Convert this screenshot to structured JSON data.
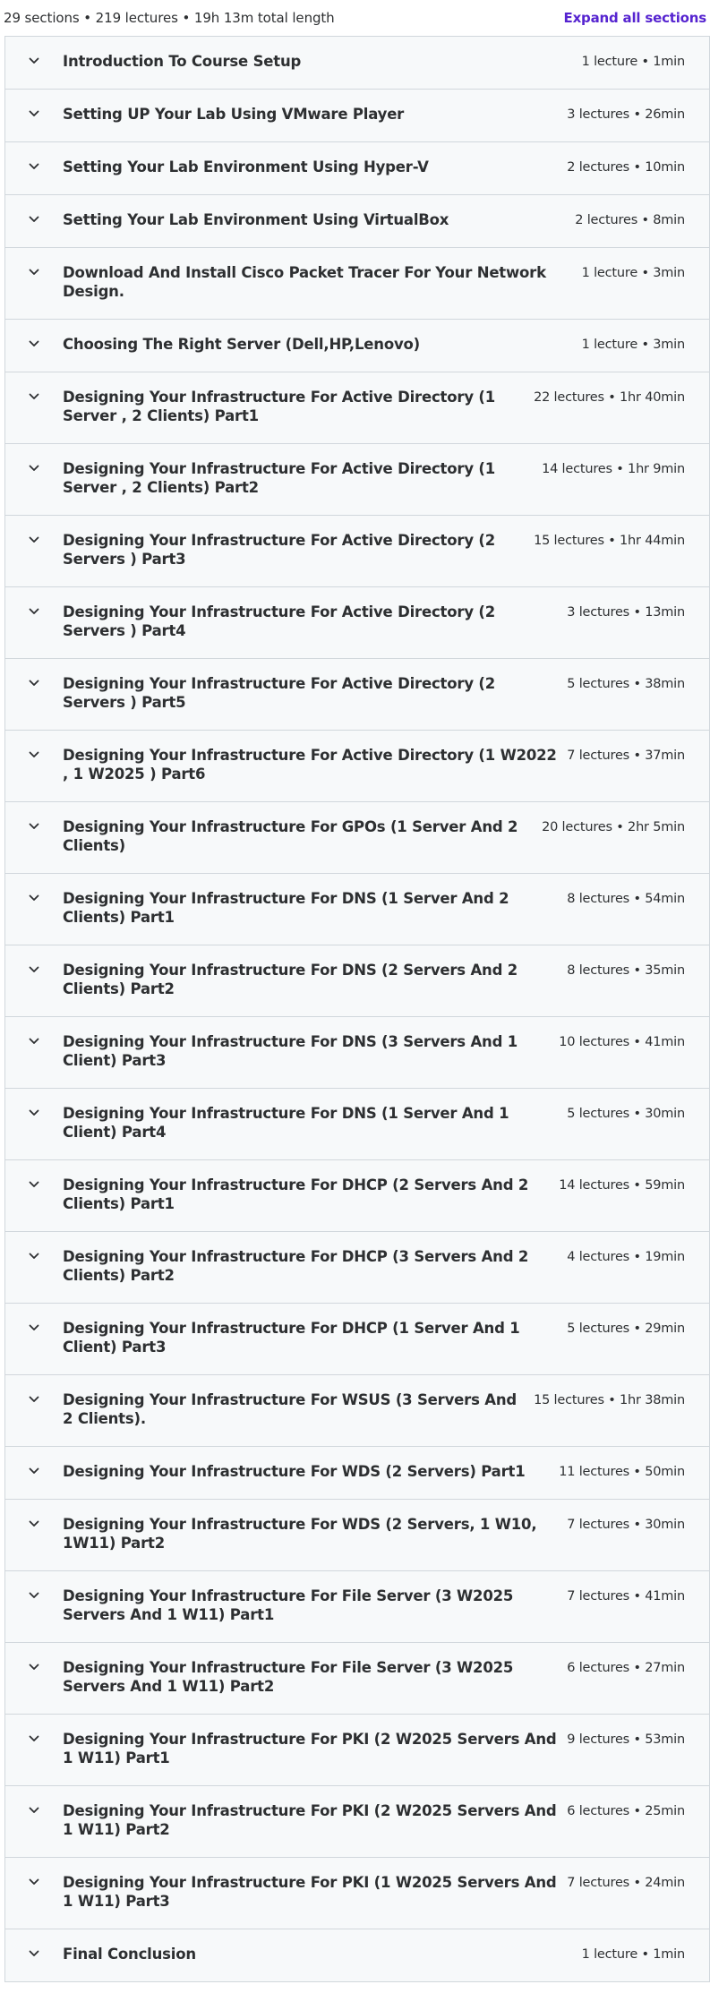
{
  "header": {
    "summary": "29 sections • 219 lectures • 19h 13m total length",
    "expand_label": "Expand all sections"
  },
  "colors": {
    "accent": "#5624d0",
    "row_bg": "#f7f9fa",
    "border": "#d1d7dc",
    "text": "#2d2f31"
  },
  "icons": {
    "toggle": "chevron-down-icon"
  },
  "sections": [
    {
      "title": "Introduction To Course Setup",
      "meta": "1 lecture • 1min"
    },
    {
      "title": "Setting UP Your Lab Using VMware Player",
      "meta": "3 lectures • 26min"
    },
    {
      "title": "Setting Your Lab Environment Using Hyper-V",
      "meta": "2 lectures • 10min"
    },
    {
      "title": "Setting Your Lab Environment Using VirtualBox",
      "meta": "2 lectures • 8min"
    },
    {
      "title": "Download And Install Cisco Packet Tracer For Your Network Design.",
      "meta": "1 lecture • 3min"
    },
    {
      "title": "Choosing The Right Server (Dell,HP,Lenovo)",
      "meta": "1 lecture • 3min"
    },
    {
      "title": "Designing Your Infrastructure For Active Directory (1 Server , 2 Clients) Part1",
      "meta": "22 lectures • 1hr 40min"
    },
    {
      "title": "Designing Your Infrastructure For Active Directory (1 Server , 2 Clients) Part2",
      "meta": "14 lectures • 1hr 9min"
    },
    {
      "title": "Designing Your Infrastructure For Active Directory (2 Servers ) Part3",
      "meta": "15 lectures • 1hr 44min"
    },
    {
      "title": "Designing Your Infrastructure For Active Directory (2 Servers ) Part4",
      "meta": "3 lectures • 13min"
    },
    {
      "title": "Designing Your Infrastructure For Active Directory (2 Servers ) Part5",
      "meta": "5 lectures • 38min"
    },
    {
      "title": "Designing Your Infrastructure For Active Directory (1 W2022 , 1 W2025 ) Part6",
      "meta": "7 lectures • 37min"
    },
    {
      "title": "Designing Your Infrastructure For GPOs (1 Server And 2 Clients)",
      "meta": "20 lectures • 2hr 5min"
    },
    {
      "title": "Designing Your Infrastructure For DNS (1 Server And 2 Clients) Part1",
      "meta": "8 lectures • 54min"
    },
    {
      "title": "Designing Your Infrastructure For DNS (2 Servers And 2 Clients) Part2",
      "meta": "8 lectures • 35min"
    },
    {
      "title": "Designing Your Infrastructure For DNS (3 Servers And 1 Client) Part3",
      "meta": "10 lectures • 41min"
    },
    {
      "title": "Designing Your Infrastructure For DNS (1 Server And 1 Client) Part4",
      "meta": "5 lectures • 30min"
    },
    {
      "title": "Designing Your Infrastructure For DHCP (2 Servers And 2 Clients) Part1",
      "meta": "14 lectures • 59min"
    },
    {
      "title": "Designing Your Infrastructure For DHCP (3 Servers And 2 Clients) Part2",
      "meta": "4 lectures • 19min"
    },
    {
      "title": "Designing Your Infrastructure For DHCP (1 Server And 1 Client) Part3",
      "meta": "5 lectures • 29min"
    },
    {
      "title": "Designing Your Infrastructure For WSUS (3 Servers And 2 Clients).",
      "meta": "15 lectures • 1hr 38min"
    },
    {
      "title": "Designing Your Infrastructure For WDS (2 Servers) Part1",
      "meta": "11 lectures • 50min"
    },
    {
      "title": "Designing Your Infrastructure For WDS (2 Servers, 1 W10, 1W11) Part2",
      "meta": "7 lectures • 30min"
    },
    {
      "title": "Designing Your Infrastructure For File Server (3 W2025 Servers And 1 W11) Part1",
      "meta": "7 lectures • 41min"
    },
    {
      "title": "Designing Your Infrastructure For File Server (3 W2025 Servers And 1 W11) Part2",
      "meta": "6 lectures • 27min"
    },
    {
      "title": "Designing Your Infrastructure For PKI (2 W2025 Servers And 1 W11) Part1",
      "meta": "9 lectures • 53min"
    },
    {
      "title": "Designing Your Infrastructure For PKI (2 W2025 Servers And 1 W11) Part2",
      "meta": "6 lectures • 25min"
    },
    {
      "title": "Designing Your Infrastructure For PKI (1 W2025 Servers And 1 W11) Part3",
      "meta": "7 lectures • 24min"
    },
    {
      "title": "Final Conclusion",
      "meta": "1 lecture • 1min"
    }
  ]
}
